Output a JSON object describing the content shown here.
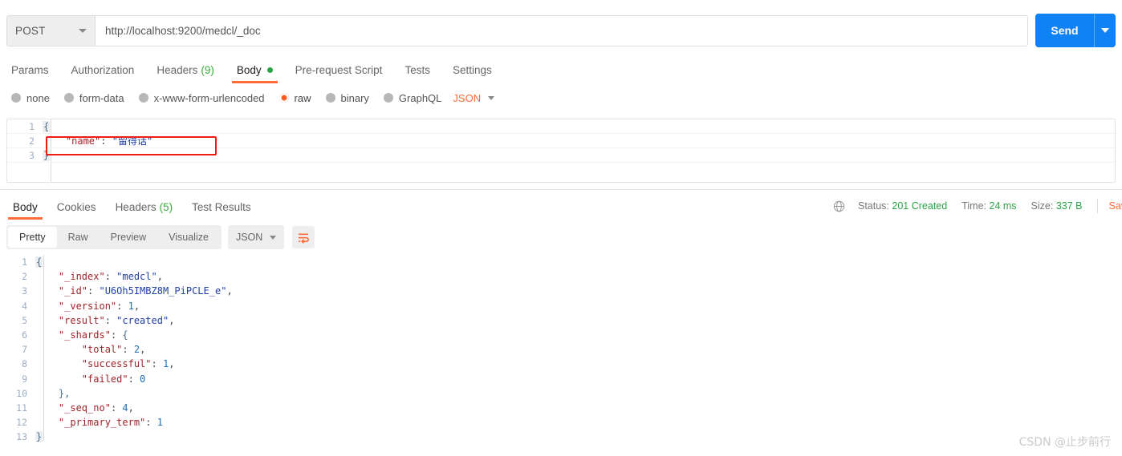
{
  "request": {
    "method": "POST",
    "url": "http://localhost:9200/medcl/_doc",
    "send_label": "Send",
    "tabs": [
      {
        "label": "Params",
        "count": "",
        "active": false,
        "dot": false
      },
      {
        "label": "Authorization",
        "count": "",
        "active": false,
        "dot": false
      },
      {
        "label": "Headers",
        "count": "(9)",
        "active": false,
        "dot": false
      },
      {
        "label": "Body",
        "count": "",
        "active": true,
        "dot": true
      },
      {
        "label": "Pre-request Script",
        "count": "",
        "active": false,
        "dot": false
      },
      {
        "label": "Tests",
        "count": "",
        "active": false,
        "dot": false
      },
      {
        "label": "Settings",
        "count": "",
        "active": false,
        "dot": false
      }
    ],
    "body_types": [
      {
        "label": "none",
        "selected": false
      },
      {
        "label": "form-data",
        "selected": false
      },
      {
        "label": "x-www-form-urlencoded",
        "selected": false
      },
      {
        "label": "raw",
        "selected": true
      },
      {
        "label": "binary",
        "selected": false
      },
      {
        "label": "GraphQL",
        "selected": false
      }
    ],
    "format_selected": "JSON",
    "body_lines": [
      {
        "n": "1",
        "text": "{"
      },
      {
        "n": "2",
        "key": "\"name\"",
        "sep": ": ",
        "value": "\"留得话\""
      },
      {
        "n": "3",
        "text": "}"
      }
    ]
  },
  "response": {
    "tabs": [
      {
        "label": "Body",
        "count": "",
        "active": true
      },
      {
        "label": "Cookies",
        "count": "",
        "active": false
      },
      {
        "label": "Headers",
        "count": "(5)",
        "active": false
      },
      {
        "label": "Test Results",
        "count": "",
        "active": false
      }
    ],
    "status": {
      "status_label": "Status:",
      "status_value": "201 Created",
      "time_label": "Time:",
      "time_value": "24 ms",
      "size_label": "Size:",
      "size_value": "337 B",
      "save_label": "Save"
    },
    "view_modes": [
      {
        "label": "Pretty",
        "active": true
      },
      {
        "label": "Raw",
        "active": false
      },
      {
        "label": "Preview",
        "active": false
      },
      {
        "label": "Visualize",
        "active": false
      }
    ],
    "format_selected": "JSON",
    "body_lines": [
      {
        "n": "1",
        "indent": 0,
        "kind": "brace",
        "text": "{"
      },
      {
        "n": "2",
        "indent": 1,
        "kind": "pair",
        "key": "\"_index\"",
        "value": "\"medcl\"",
        "vtype": "str",
        "comma": ","
      },
      {
        "n": "3",
        "indent": 1,
        "kind": "pair",
        "key": "\"_id\"",
        "value": "\"U6Oh5IMBZ8M_PiPCLE_e\"",
        "vtype": "str",
        "comma": ","
      },
      {
        "n": "4",
        "indent": 1,
        "kind": "pair",
        "key": "\"_version\"",
        "value": "1",
        "vtype": "num",
        "comma": ","
      },
      {
        "n": "5",
        "indent": 1,
        "kind": "pair",
        "key": "\"result\"",
        "value": "\"created\"",
        "vtype": "str",
        "comma": ","
      },
      {
        "n": "6",
        "indent": 1,
        "kind": "pair",
        "key": "\"_shards\"",
        "value": "{",
        "vtype": "open",
        "comma": ""
      },
      {
        "n": "7",
        "indent": 2,
        "kind": "pair",
        "key": "\"total\"",
        "value": "2",
        "vtype": "num",
        "comma": ","
      },
      {
        "n": "8",
        "indent": 2,
        "kind": "pair",
        "key": "\"successful\"",
        "value": "1",
        "vtype": "num",
        "comma": ","
      },
      {
        "n": "9",
        "indent": 2,
        "kind": "pair",
        "key": "\"failed\"",
        "value": "0",
        "vtype": "num",
        "comma": ""
      },
      {
        "n": "10",
        "indent": 1,
        "kind": "close",
        "text": "},"
      },
      {
        "n": "11",
        "indent": 1,
        "kind": "pair",
        "key": "\"_seq_no\"",
        "value": "4",
        "vtype": "num",
        "comma": ","
      },
      {
        "n": "12",
        "indent": 1,
        "kind": "pair",
        "key": "\"_primary_term\"",
        "value": "1",
        "vtype": "num",
        "comma": ""
      },
      {
        "n": "13",
        "indent": 0,
        "kind": "brace",
        "text": "}"
      }
    ]
  },
  "watermark": "CSDN @止步前行",
  "colors": {
    "accent_orange": "#ff6c37",
    "send_blue": "#0f83f5",
    "status_green": "#2aa446",
    "annotation_red": "#ee1c12"
  }
}
